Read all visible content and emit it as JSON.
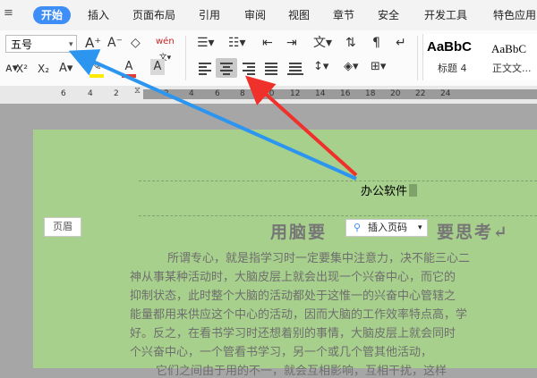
{
  "menu": {
    "tabs": [
      "开始",
      "插入",
      "页面布局",
      "引用",
      "审阅",
      "视图",
      "章节",
      "安全",
      "开发工具",
      "特色应用"
    ]
  },
  "ribbon": {
    "font_size": "五号",
    "superscript": "X²",
    "subscript": "X₂",
    "font_color_letter": "A",
    "char_shade_letter": "A",
    "grow_font": "A⁺",
    "shrink_font": "A⁻",
    "pinyin_label": "wén",
    "styles": [
      {
        "preview": "AaBbC",
        "name": "标题 4"
      },
      {
        "preview": "AaBbC",
        "name": "正文文..."
      }
    ]
  },
  "ruler": {
    "numbers": [
      "6",
      "4",
      "2",
      "2",
      "4",
      "6",
      "8",
      "10",
      "12",
      "14",
      "16",
      "18",
      "20",
      "22",
      "24"
    ]
  },
  "document": {
    "header_label": "页眉",
    "header_text": "办公软件",
    "insert_page_number": "插入页码",
    "title_left": "用脑要",
    "title_right": "要思考↵",
    "lines": [
      "所谓专心，就是指学习时一定要集中注意力，决不能三心二",
      "神从事某种活动时，大脑皮层上就会出现一个兴奋中心，而它的",
      "抑制状态，此时整个大脑的活动都处于这惟一的兴奋中心管辖之",
      "能量都用来供应这个中心的活动，因而大脑的工作效率特点高，学",
      "好。反之，在看书学习时还想着别的事情，大脑皮层上就会同时",
      "个兴奋中心，一个管看书学习，另一个或几个管其他活动，",
      "它们之间由于用的不一，就会互相影响，互相干扰，这样"
    ]
  },
  "colors": {
    "accent": "#3e8ef7",
    "page": "#a8d08d",
    "arrow_blue": "#2b95f0",
    "arrow_red": "#f0302a"
  }
}
